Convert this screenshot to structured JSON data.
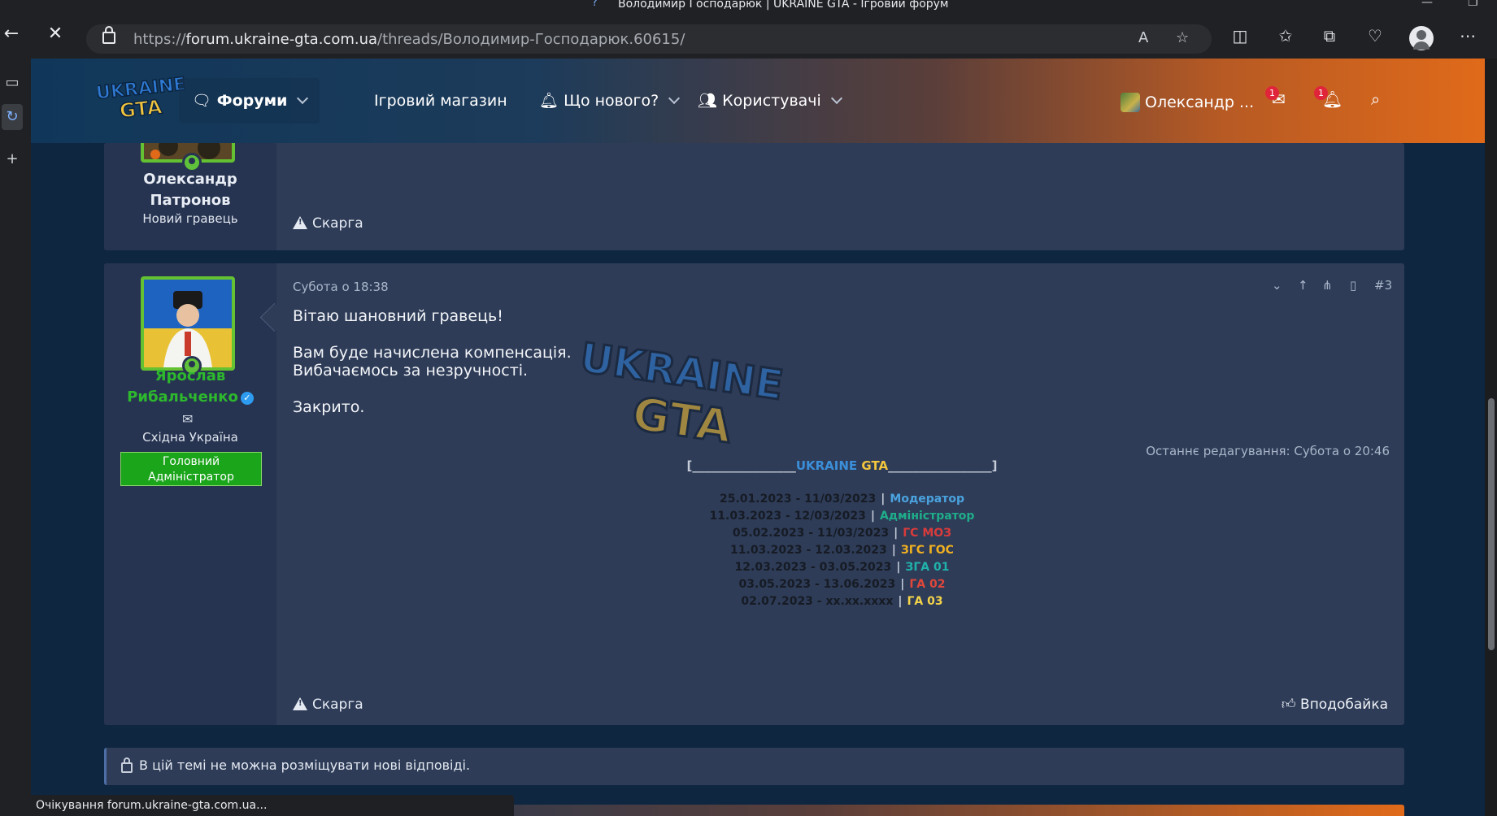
{
  "window": {
    "title": "Володимир Господарюк | UKRAINE GTA - Ігровий форум"
  },
  "browser": {
    "url_scheme": "https://",
    "url_host": "forum.ukraine-gta.com.ua",
    "url_path": "/threads/Володимир-Господарюк.60615/",
    "read_aloud": "A",
    "status_text": "Очікування forum.ukraine-gta.com.ua..."
  },
  "header": {
    "nav": {
      "forums": "Форуми",
      "shop": "Ігровий магазин",
      "whats_new": "Що нового?",
      "users": "Користувачі"
    },
    "user_name": "Олександр ...",
    "messages_badge": "1",
    "alerts_badge": "1"
  },
  "posts": [
    {
      "author_first": "Олександр",
      "author_last": "Патронов",
      "author_title": "Новий гравець",
      "report_label": "Скарга"
    },
    {
      "date": "Субота о 18:38",
      "number": "#3",
      "author_first": "Ярослав",
      "author_last": "Рибальченко",
      "location": "Східна Україна",
      "role_line1": "Головний",
      "role_line2": "Адміністратор",
      "lines": [
        "Вітаю шановний гравець!",
        "Вам буде начислена компенсація.",
        "Вибачаємось за незручності.",
        "Закрито."
      ],
      "edit_note": "Останнє редагування: Субота о 20:46",
      "sig_bracket_left": "[_________________",
      "sig_brand_a": "UKRAINE",
      "sig_brand_b": "GTA",
      "sig_bracket_right": "_________________]",
      "signature": [
        {
          "dates": "25.01.2023 - 11/03/2023",
          "sep": "|",
          "role": "Модератор",
          "color": "#4aa3df"
        },
        {
          "dates": "11.03.2023 - 12/03/2023",
          "sep": "|",
          "role": "Адміністратор",
          "color": "#1fae8a"
        },
        {
          "dates": "05.02.2023 - 11/03/2023",
          "sep": "|",
          "role": "ГС МОЗ",
          "color": "#d93b3b"
        },
        {
          "dates": "11.03.2023 - 12.03.2023",
          "sep": "|",
          "role": "ЗГС ГОС",
          "color": "#f0b020"
        },
        {
          "dates": "12.03.2023 - 03.05.2023",
          "sep": "|",
          "role": "ЗГА 01",
          "color": "#20b2aa"
        },
        {
          "dates": "03.05.2023 - 13.06.2023",
          "sep": "|",
          "role": "ГА 02",
          "color": "#e0473a"
        },
        {
          "dates": "02.07.2023 - xx.xx.xxxx",
          "sep": "|",
          "role": "ГА 03",
          "color": "#f3d34a"
        }
      ],
      "report_label": "Скарга",
      "like_label": "Вподобайка"
    }
  ],
  "locked_message": "В цій темі не можна розміщувати нові відповіді.",
  "colors": {
    "accent_green": "#63c132",
    "role_green": "#1aa51a",
    "brand_orange": "#e06a1a",
    "brand_blue": "#10375a"
  }
}
